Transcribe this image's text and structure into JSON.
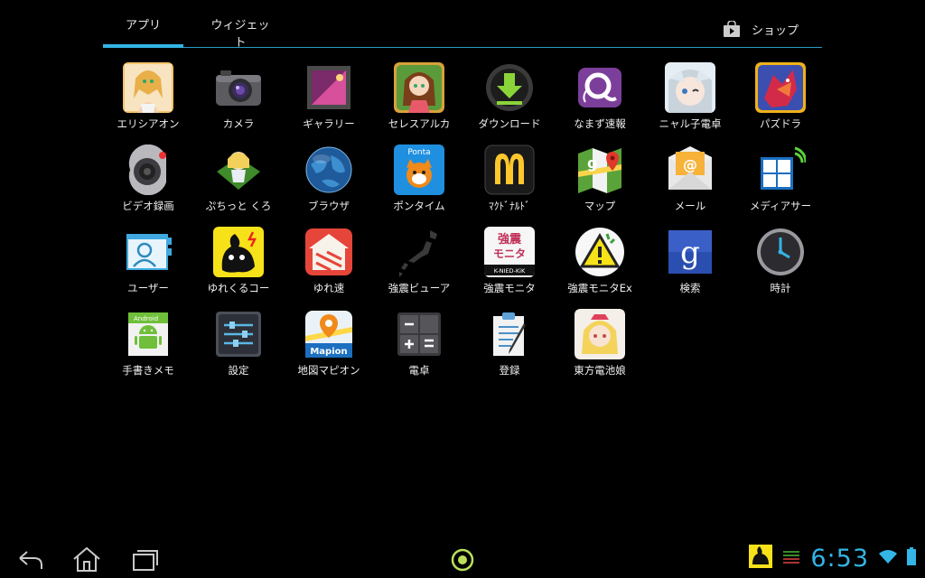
{
  "tabs": {
    "apps_label": "アプリ",
    "widgets_label": "ウィジェット",
    "shop_label": "ショップ"
  },
  "apps": [
    {
      "label": "エリシアオン",
      "icon": "elysion-game-icon"
    },
    {
      "label": "カメラ",
      "icon": "camera-icon"
    },
    {
      "label": "ギャラリー",
      "icon": "gallery-icon"
    },
    {
      "label": "セレスアルカ",
      "icon": "celes-arca-game-icon"
    },
    {
      "label": "ダウンロード",
      "icon": "download-icon"
    },
    {
      "label": "なまず速報",
      "icon": "namazu-catfish-icon"
    },
    {
      "label": "ニャル子電卓",
      "icon": "nyaruko-calculator-icon"
    },
    {
      "label": "パズドラ",
      "icon": "puzzle-dragons-icon"
    },
    {
      "label": "ビデオ録画",
      "icon": "video-recorder-icon"
    },
    {
      "label": "ぷちっと くろ",
      "icon": "puchitto-game-icon"
    },
    {
      "label": "ブラウザ",
      "icon": "browser-globe-icon"
    },
    {
      "label": "ポンタイム",
      "icon": "ponta-icon"
    },
    {
      "label": "ﾏｸﾄﾞﾅﾙﾄﾞ",
      "icon": "mcdonalds-icon"
    },
    {
      "label": "マップ",
      "icon": "maps-icon"
    },
    {
      "label": "メール",
      "icon": "email-icon"
    },
    {
      "label": "メディアサー",
      "icon": "media-server-icon"
    },
    {
      "label": "ユーザー",
      "icon": "user-contacts-icon"
    },
    {
      "label": "ゆれくるコー",
      "icon": "yurekuru-call-icon"
    },
    {
      "label": "ゆれ速",
      "icon": "yuresoku-icon"
    },
    {
      "label": "強震ビューア",
      "icon": "japan-map-icon"
    },
    {
      "label": "強震モニタ",
      "icon": "kyoshin-monitor-icon"
    },
    {
      "label": "強震モニタEx",
      "icon": "warning-icon"
    },
    {
      "label": "検索",
      "icon": "google-search-icon"
    },
    {
      "label": "時計",
      "icon": "clock-icon"
    },
    {
      "label": "手書きメモ",
      "icon": "handwriting-memo-icon"
    },
    {
      "label": "設定",
      "icon": "settings-icon"
    },
    {
      "label": "地図マピオン",
      "icon": "mapion-icon"
    },
    {
      "label": "電卓",
      "icon": "calculator-icon"
    },
    {
      "label": "登録",
      "icon": "registration-clipboard-icon"
    },
    {
      "label": "東方電池娘",
      "icon": "touhou-battery-icon"
    }
  ],
  "icon_text": {
    "ponta": "Ponta",
    "mapion": "Mapion",
    "kyoshin_1": "強震",
    "kyoshin_2": "モニタ",
    "kyoshin_3": "K-NIED-KiK",
    "android": "Android",
    "google_g": "g",
    "mail_at": "@"
  },
  "status": {
    "time": "6:53"
  },
  "colors": {
    "accent": "#33b5e5",
    "background": "#000000"
  }
}
